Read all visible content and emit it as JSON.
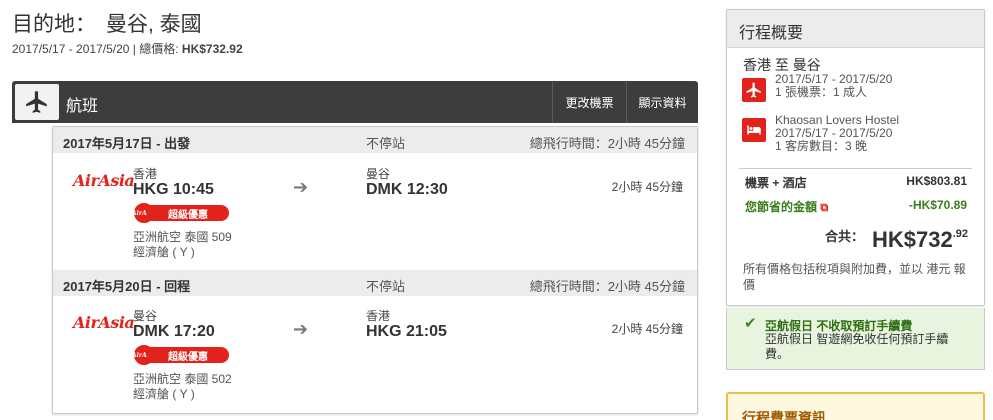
{
  "header": {
    "dest_label": "目的地：",
    "dest_value": "曼谷, 泰國",
    "dates": "2017/5/17 - 2017/5/20",
    "total_label": "總價格:",
    "total_value": "HK$732.92"
  },
  "flight_panel": {
    "title": "航班",
    "change_button": "更改機票",
    "details_button": "顯示資料",
    "icon": "airplane-icon"
  },
  "segments": [
    {
      "date": "2017年5月17日 - 出發",
      "stops": "不停站",
      "total_duration": "總飛行時間：2小時 45分鐘",
      "airline_logo": "AirAsia",
      "dep_city": "香港",
      "dep_time": "HKG 10:45",
      "promo_badge": "超級優惠",
      "airline_name": "亞洲航空 泰國 509",
      "cabin": "經濟艙 ( Y )",
      "arr_city": "曼谷",
      "arr_time": "DMK 12:30",
      "duration": "2小時 45分鐘"
    },
    {
      "date": "2017年5月20日 - 回程",
      "stops": "不停站",
      "total_duration": "總飛行時間：2小時 45分鐘",
      "airline_logo": "AirAsia",
      "dep_city": "曼谷",
      "dep_time": "DMK 17:20",
      "promo_badge": "超級優惠",
      "airline_name": "亞洲航空 泰國 502",
      "cabin": "經濟艙 ( Y )",
      "arr_city": "香港",
      "arr_time": "HKG 21:05",
      "duration": "2小時 45分鐘"
    }
  ],
  "summary": {
    "title": "行程概要",
    "route": "香港 至 曼谷",
    "flight": {
      "icon": "airplane-icon",
      "dates": "2017/5/17 - 2017/5/20",
      "pax": "1 張機票：1 成人"
    },
    "hotel": {
      "icon": "bed-icon",
      "name": "Khaosan Lovers Hostel",
      "dates": "2017/5/17 - 2017/5/20",
      "rooms": "1 客房數目：3 晚"
    },
    "package_label": "機票 + 酒店",
    "package_value": "HK$803.81",
    "savings_label": "您節省的金額",
    "savings_value": "-HK$70.89",
    "total_label": "合共：",
    "total_main": "HK$732",
    "total_cents": ".92",
    "tax_note": "所有價格包括稅項與附加費，並以 港元 報價"
  },
  "promo": {
    "title": "亞航假日 不收取預訂手續費",
    "desc": "亞航假日 智遊網免收任何預訂手續費。"
  },
  "fare_info": {
    "title": "行程費票資訊"
  },
  "colors": {
    "brand_red": "#e1231b",
    "header_dark": "#3d3d3d",
    "savings_green": "#3a7d1e",
    "promo_bg": "#e9f4df"
  }
}
